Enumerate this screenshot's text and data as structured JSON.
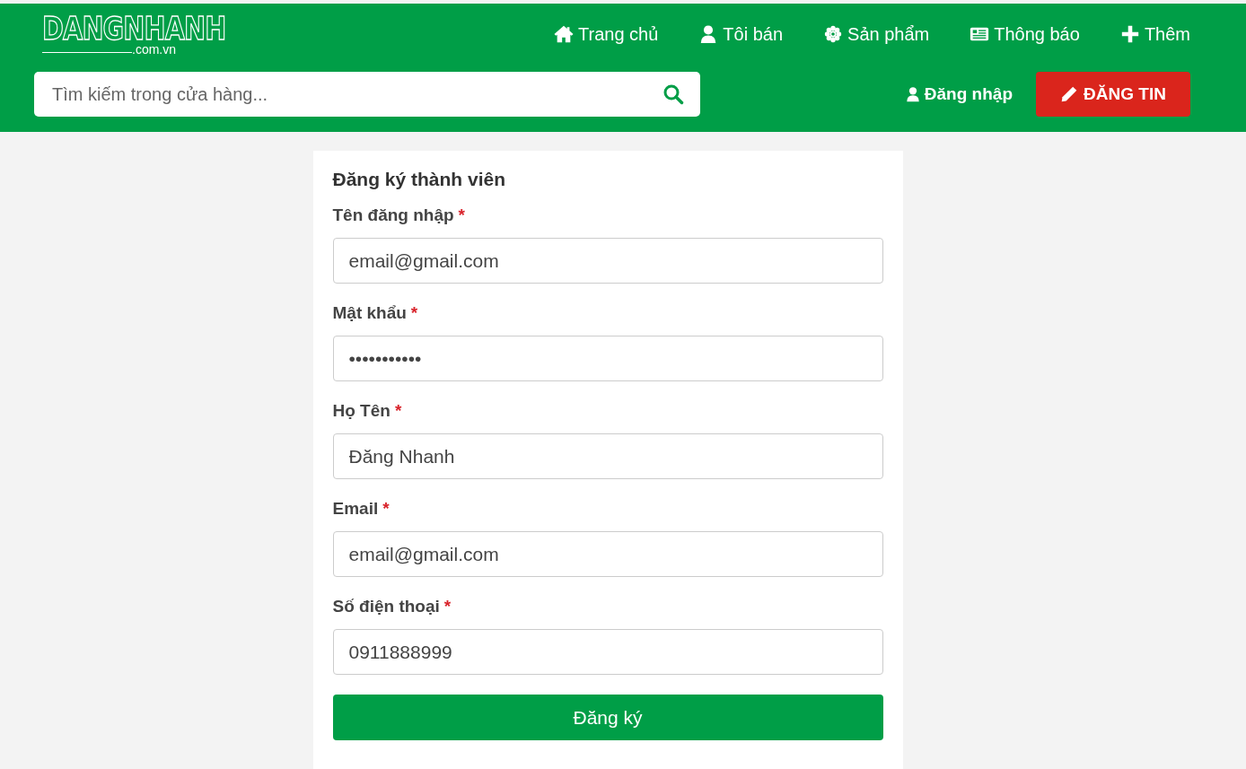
{
  "logo": {
    "name": "DANGNHANH",
    "domain": ".com.vn"
  },
  "nav": [
    {
      "label": "Trang chủ"
    },
    {
      "label": "Tôi bán"
    },
    {
      "label": "Sản phẩm"
    },
    {
      "label": "Thông báo"
    },
    {
      "label": "Thêm"
    }
  ],
  "search": {
    "placeholder": "Tìm kiếm trong cửa hàng..."
  },
  "login": {
    "label": "Đăng nhập"
  },
  "post_button": {
    "label": "ĐĂNG TIN"
  },
  "form": {
    "title": "Đăng ký thành viên",
    "fields": [
      {
        "label": "Tên đăng nhập",
        "required_mark": "*",
        "value": "email@gmail.com"
      },
      {
        "label": "Mật khẩu",
        "required_mark": "*",
        "value": "•••••••••••"
      },
      {
        "label": "Họ Tên",
        "required_mark": "*",
        "value": "Đăng Nhanh"
      },
      {
        "label": "Email",
        "required_mark": "*",
        "value": "email@gmail.com"
      },
      {
        "label": "Số điện thoại",
        "required_mark": "*",
        "value": "0911888999"
      }
    ],
    "submit": "Đăng ký"
  }
}
